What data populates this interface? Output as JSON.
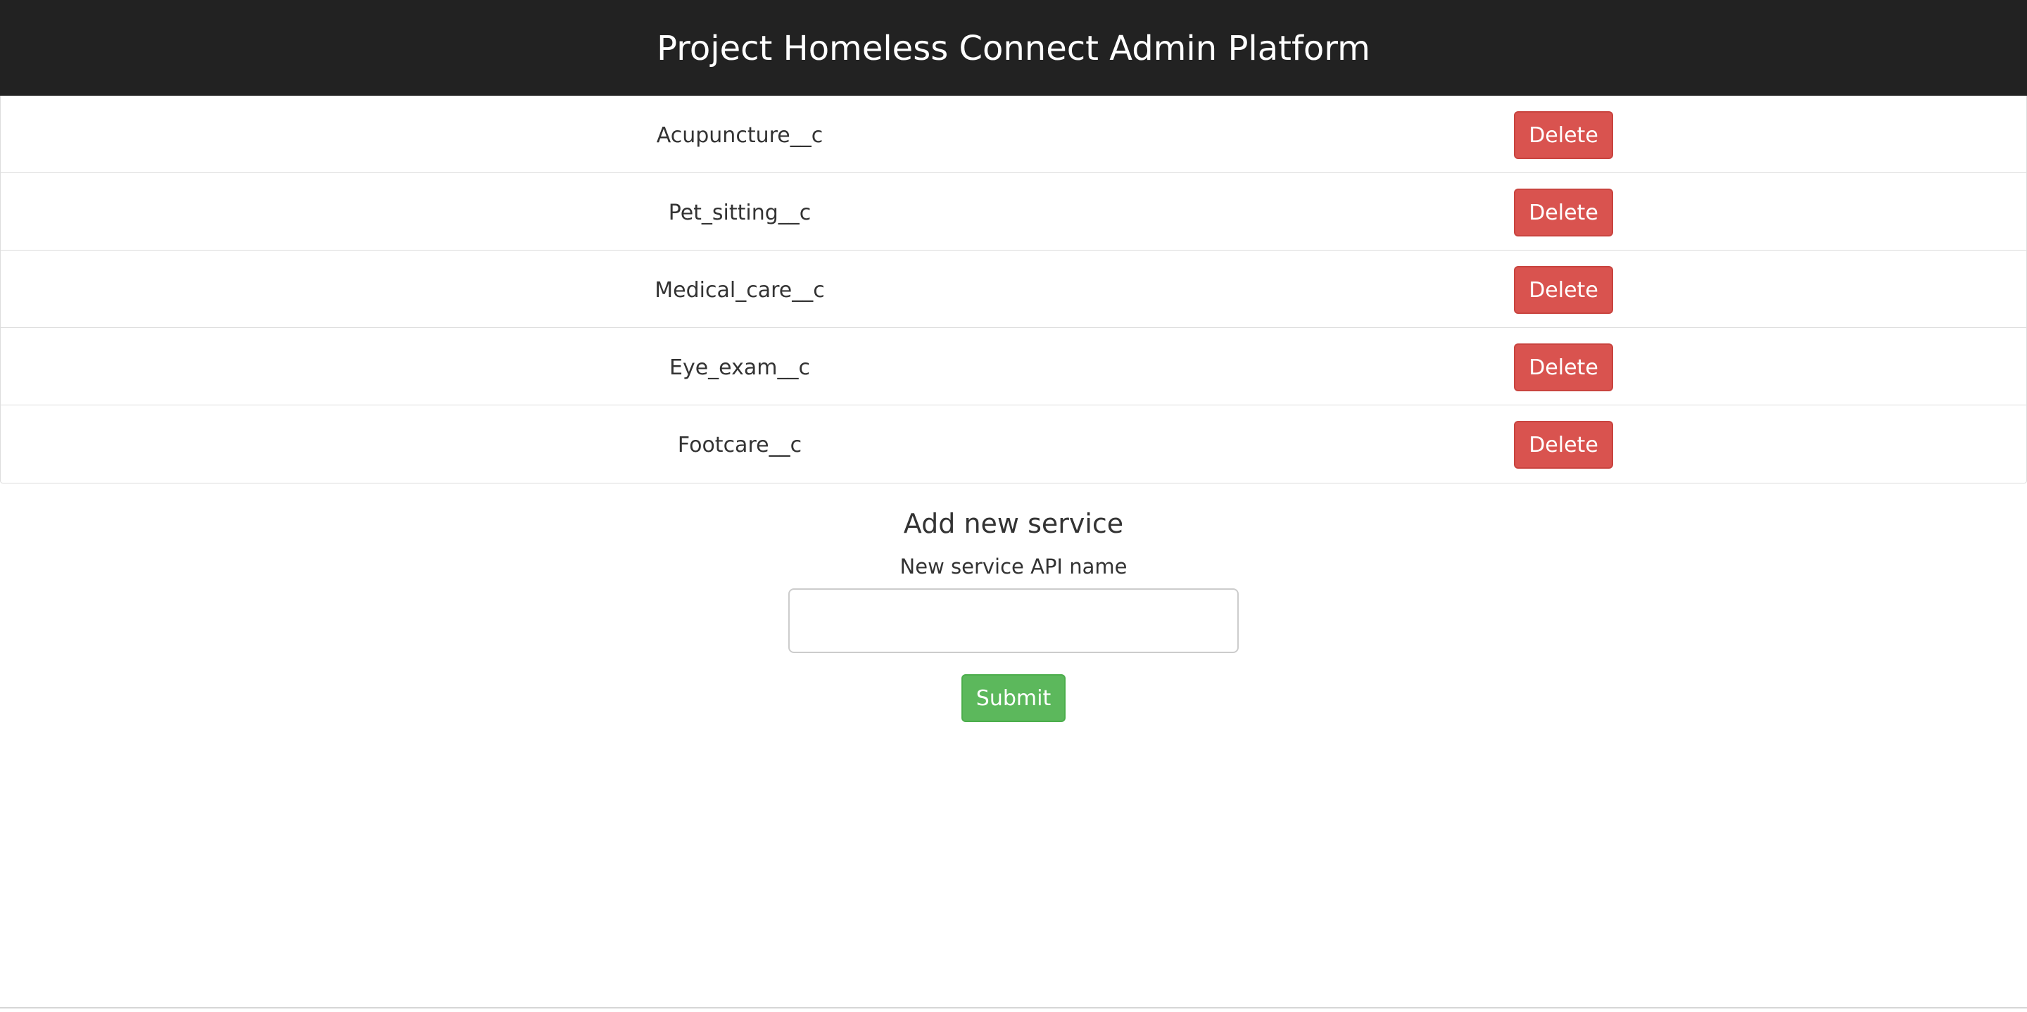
{
  "header": {
    "title": "Project Homeless Connect Admin Platform"
  },
  "services": [
    {
      "name": "Acupuncture__c",
      "delete_label": "Delete"
    },
    {
      "name": "Pet_sitting__c",
      "delete_label": "Delete"
    },
    {
      "name": "Medical_care__c",
      "delete_label": "Delete"
    },
    {
      "name": "Eye_exam__c",
      "delete_label": "Delete"
    },
    {
      "name": "Footcare__c",
      "delete_label": "Delete"
    }
  ],
  "add_form": {
    "title": "Add new service",
    "field_label": "New service API name",
    "input_value": "",
    "submit_label": "Submit"
  },
  "colors": {
    "header_bg": "#222222",
    "delete_button": "#d9534f",
    "submit_button": "#5cb85c"
  }
}
